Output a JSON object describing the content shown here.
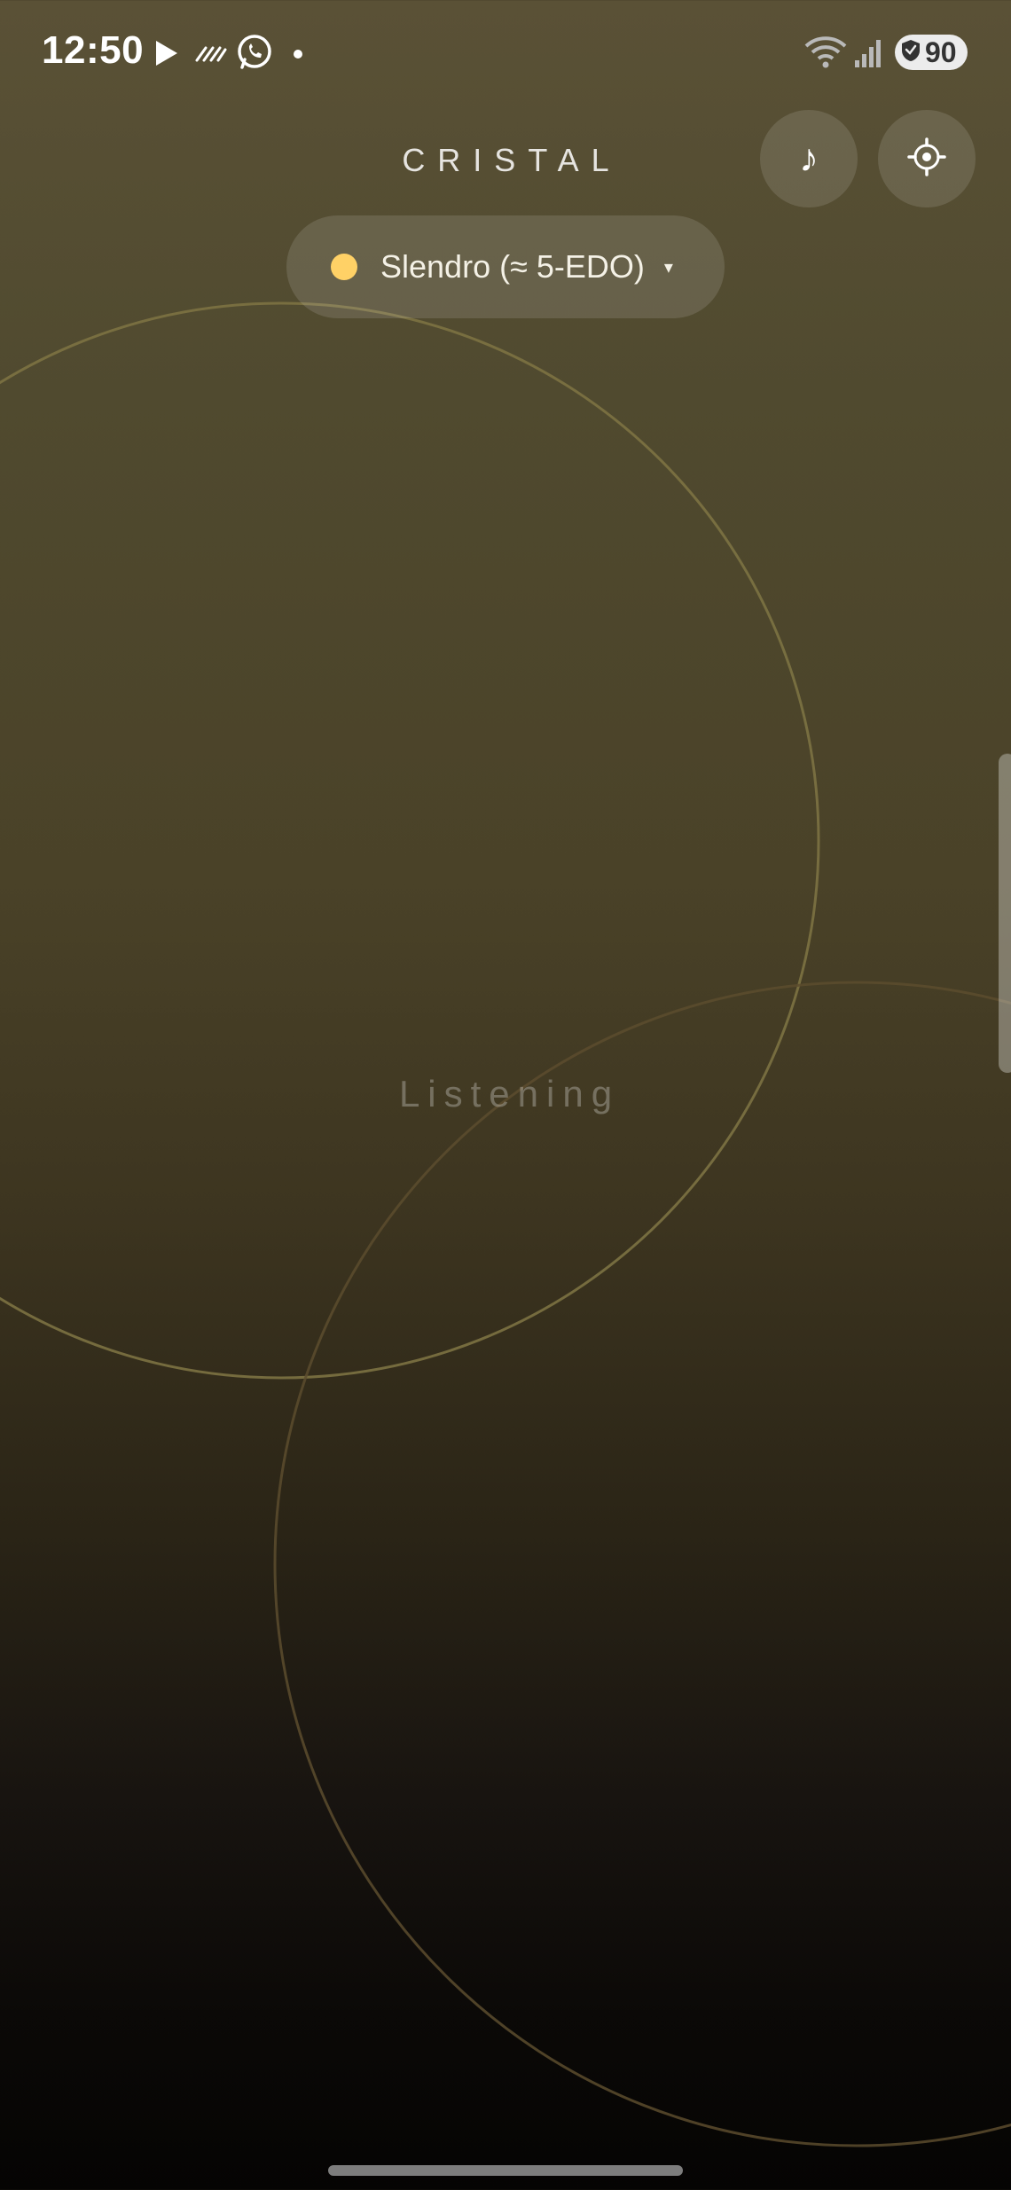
{
  "status_bar": {
    "time": "12:50",
    "battery": "90",
    "left_icons": [
      "play-icon",
      "data-saver-icon",
      "whatsapp-icon",
      "notification-dot-icon"
    ],
    "right_icons": [
      "wifi-icon",
      "cellular-signal-icon",
      "battery-icon"
    ]
  },
  "header": {
    "title": "CRISTAL",
    "music_button_glyph": "♪",
    "settings_icon": "gear-icon"
  },
  "scale_selector": {
    "label": "Slendro (≈ 5-EDO)",
    "caret": "▾",
    "dot_color": "#ffd166"
  },
  "main": {
    "status_text": "Listening"
  },
  "colors": {
    "background_top": "#5a5136",
    "background_bottom": "#050403",
    "accent": "#ffd166"
  }
}
